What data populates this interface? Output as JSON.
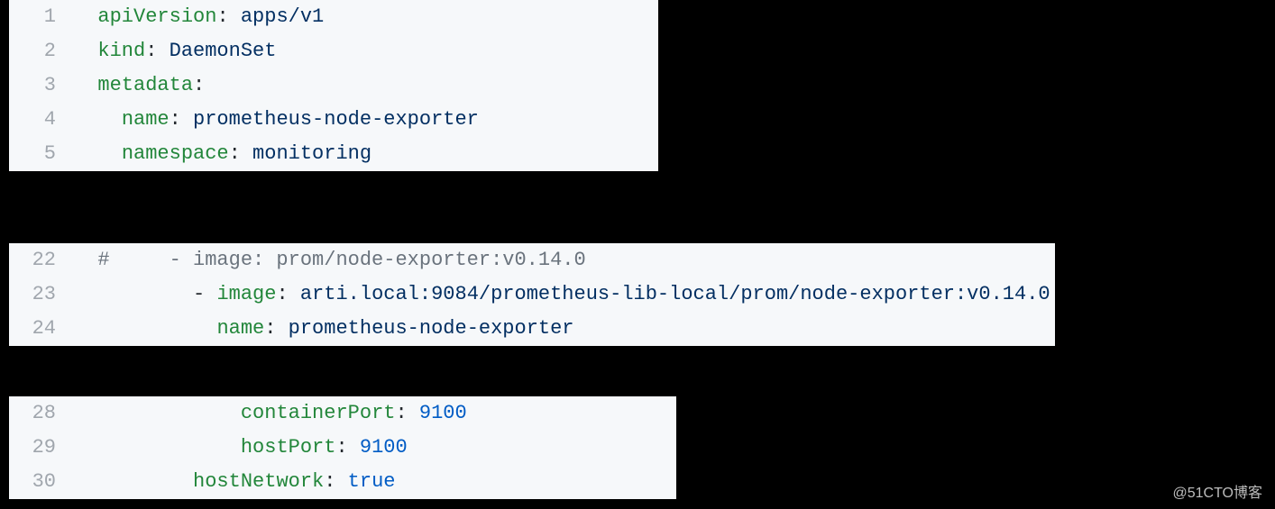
{
  "watermark": "@51CTO博客",
  "blocks": [
    {
      "cls": "block1",
      "lines": [
        {
          "num": "1",
          "tokens": [
            [
              "  ",
              ""
            ],
            [
              "apiVersion",
              "key"
            ],
            [
              ": ",
              "punct"
            ],
            [
              "apps/v1",
              "str"
            ]
          ]
        },
        {
          "num": "2",
          "tokens": [
            [
              "  ",
              ""
            ],
            [
              "kind",
              "key"
            ],
            [
              ": ",
              "punct"
            ],
            [
              "DaemonSet",
              "str"
            ]
          ]
        },
        {
          "num": "3",
          "tokens": [
            [
              "  ",
              ""
            ],
            [
              "metadata",
              "key"
            ],
            [
              ":",
              "punct"
            ]
          ]
        },
        {
          "num": "4",
          "tokens": [
            [
              "    ",
              ""
            ],
            [
              "name",
              "key"
            ],
            [
              ": ",
              "punct"
            ],
            [
              "prometheus-node-exporter",
              "str"
            ]
          ]
        },
        {
          "num": "5",
          "tokens": [
            [
              "    ",
              ""
            ],
            [
              "namespace",
              "key"
            ],
            [
              ": ",
              "punct"
            ],
            [
              "monitoring",
              "str"
            ]
          ]
        }
      ]
    },
    {
      "cls": "block2",
      "lines": [
        {
          "num": "22",
          "tokens": [
            [
              "  #     - image: prom/node-exporter:v0.14.0",
              "comment"
            ]
          ]
        },
        {
          "num": "23",
          "tokens": [
            [
              "          ",
              ""
            ],
            [
              "- ",
              "dash"
            ],
            [
              "image",
              "key"
            ],
            [
              ": ",
              "punct"
            ],
            [
              "arti.local:9084/prometheus-lib-local/prom/node-exporter:v0.14.0",
              "str"
            ]
          ]
        },
        {
          "num": "24",
          "tokens": [
            [
              "            ",
              ""
            ],
            [
              "name",
              "key"
            ],
            [
              ": ",
              "punct"
            ],
            [
              "prometheus-node-exporter",
              "str"
            ]
          ]
        }
      ]
    },
    {
      "cls": "block3",
      "lines": [
        {
          "num": "28",
          "tokens": [
            [
              "              ",
              ""
            ],
            [
              "containerPort",
              "key"
            ],
            [
              ": ",
              "punct"
            ],
            [
              "9100",
              "num"
            ]
          ]
        },
        {
          "num": "29",
          "tokens": [
            [
              "              ",
              ""
            ],
            [
              "hostPort",
              "key"
            ],
            [
              ": ",
              "punct"
            ],
            [
              "9100",
              "num"
            ]
          ]
        },
        {
          "num": "30",
          "tokens": [
            [
              "          ",
              ""
            ],
            [
              "hostNetwork",
              "key"
            ],
            [
              ": ",
              "punct"
            ],
            [
              "true",
              "bool"
            ]
          ]
        }
      ]
    }
  ]
}
